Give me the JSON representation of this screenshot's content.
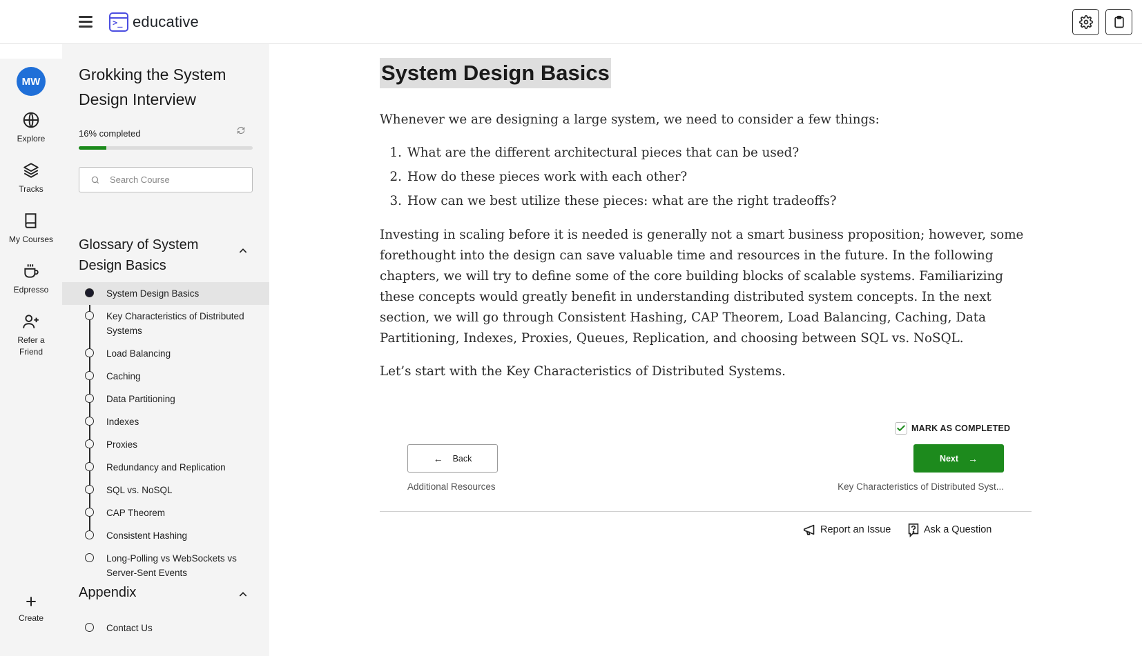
{
  "brand": {
    "name": "educative",
    "color": "#4b4de0"
  },
  "rail": {
    "avatar_initials": "MW",
    "items": [
      {
        "label": "Explore",
        "icon": "globe-icon"
      },
      {
        "label": "Tracks",
        "icon": "layers-icon"
      },
      {
        "label": "My Courses",
        "icon": "book-icon"
      },
      {
        "label": "Edpresso",
        "icon": "coffee-cup-icon"
      },
      {
        "label": "Refer a Friend",
        "icon": "user-plus-icon"
      },
      {
        "label": "Create",
        "icon": "plus-icon"
      }
    ]
  },
  "course": {
    "title": "Grokking the System Design Interview",
    "progress_label": "16% completed",
    "progress_fraction": 0.16,
    "progress_color": "#1b8a1b",
    "search_placeholder": "Search Course",
    "sections": [
      {
        "title": "Glossary of System Design Basics",
        "lessons": [
          {
            "label": "System Design Basics",
            "active": true
          },
          {
            "label": "Key Characteristics of Distributed Systems"
          },
          {
            "label": "Load Balancing"
          },
          {
            "label": "Caching"
          },
          {
            "label": "Data Partitioning"
          },
          {
            "label": "Indexes"
          },
          {
            "label": "Proxies"
          },
          {
            "label": "Redundancy and Replication"
          },
          {
            "label": "SQL vs. NoSQL"
          },
          {
            "label": "CAP Theorem"
          },
          {
            "label": "Consistent Hashing"
          },
          {
            "label": "Long-Polling vs WebSockets vs Server-Sent Events"
          }
        ]
      },
      {
        "title": "Appendix",
        "lessons": [
          {
            "label": "Contact Us"
          }
        ]
      }
    ]
  },
  "article": {
    "title": "System Design Basics",
    "intro": "Whenever we are designing a large system, we need to consider a few things:",
    "questions": [
      {
        "num": "1.",
        "text": "What are the different architectural pieces that can be used?"
      },
      {
        "num": "2.",
        "text": "How do these pieces work with each other?"
      },
      {
        "num": "3.",
        "text": "How can we best utilize these pieces: what are the right tradeoffs?"
      }
    ],
    "paragraph": "Investing in scaling before it is needed is generally not a smart business proposition; however, some forethought into the design can save valuable time and resources in the future. In the following chapters, we will try to define some of the core building blocks of scalable systems. Familiarizing these concepts would greatly benefit in understanding distributed system concepts. In the next section, we will go through Consistent Hashing, CAP Theorem, Load Balancing, Caching, Data Partitioning, Indexes, Proxies, Queues, Replication, and choosing between SQL vs. NoSQL.",
    "closing": "Let’s start with the Key Characteristics of Distributed Systems."
  },
  "navigation": {
    "mark_completed_label": "MARK AS COMPLETED",
    "mark_completed_checked": true,
    "back_label": "Back",
    "next_label": "Next",
    "prev_lesson": "Additional Resources",
    "next_lesson": "Key Characteristics of Distributed Syst...",
    "next_color": "#1d8a1d"
  },
  "footer": {
    "report_label": "Report an Issue",
    "ask_label": "Ask a Question"
  }
}
